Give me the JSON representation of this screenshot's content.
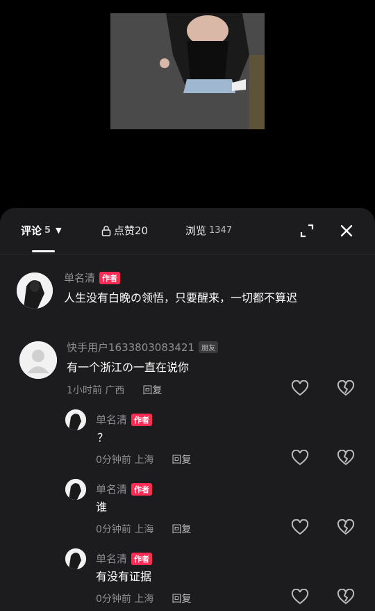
{
  "tabs": {
    "comments_label": "评论",
    "comments_count": "5",
    "likes_label": "点赞20",
    "views_label": "浏览",
    "views_count": "1347"
  },
  "comments": [
    {
      "name": "单名清",
      "badge": "作者",
      "text": "人生没有白晚の领悟，只要醒来，一切都不算迟"
    },
    {
      "name": "快手用户1633803083421",
      "badge": "朋友",
      "text": "有一个浙江の一直在说你",
      "time": "1小时前 广西",
      "reply": "回复"
    },
    {
      "name": "单名清",
      "badge": "作者",
      "text": "？",
      "time": "0分钟前 上海",
      "reply": "回复"
    },
    {
      "name": "单名清",
      "badge": "作者",
      "text": "谁",
      "time": "0分钟前 上海",
      "reply": "回复"
    },
    {
      "name": "单名清",
      "badge": "作者",
      "text": "有没有证据",
      "time": "0分钟前 上海",
      "reply": "回复"
    }
  ]
}
